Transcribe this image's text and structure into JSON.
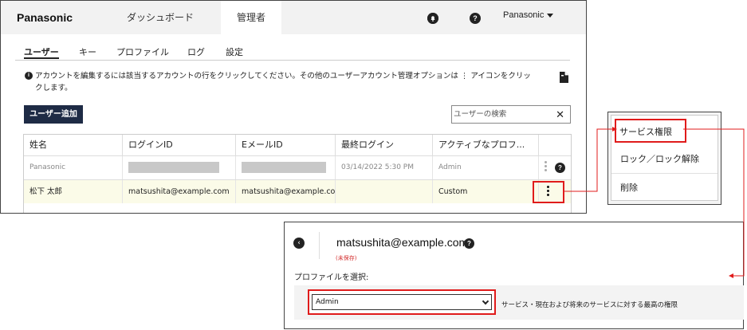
{
  "header": {
    "brand": "Panasonic",
    "nav": [
      "ダッシュボード",
      "管理者"
    ],
    "user_menu": "Panasonic"
  },
  "subtabs": [
    "ユーザー",
    "キー",
    "プロファイル",
    "ログ",
    "設定"
  ],
  "info": {
    "text": "アカウントを編集するには該当するアカウントの行をクリックしてください。その他のユーザーアカウント管理オプションは ⋮ アイコンをクリックします。"
  },
  "toolbar": {
    "add_user_label": "ユーザー追加",
    "search_placeholder": "ユーザーの検索"
  },
  "table": {
    "columns": [
      "姓名",
      "ログインID",
      "EメールID",
      "最終ログイン",
      "アクティブなプロフ..."
    ],
    "rows": [
      {
        "name": "Panasonic",
        "login_id": "",
        "email_id": "",
        "last_login": "03/14/2022 5:30 PM",
        "profile": "Admin"
      },
      {
        "name": "松下 太郎",
        "login_id": "matsushita@example.com",
        "email_id": "matsushita@example.com",
        "last_login": "",
        "profile": "Custom"
      }
    ]
  },
  "context_menu": {
    "items": [
      "サービス権限",
      "ロック／ロック解除",
      "削除"
    ]
  },
  "detail": {
    "email": "matsushita@example.com",
    "unsaved": "(未保存)",
    "profile_label": "プロファイルを選択:",
    "selected_profile": "Admin",
    "profile_description": "サービス・現在および将来のサービスに対する最高の権限"
  },
  "colors": {
    "accent_red": "#e01b1b",
    "button_navy": "#1e2b45",
    "selected_row": "#fbfbe8"
  }
}
